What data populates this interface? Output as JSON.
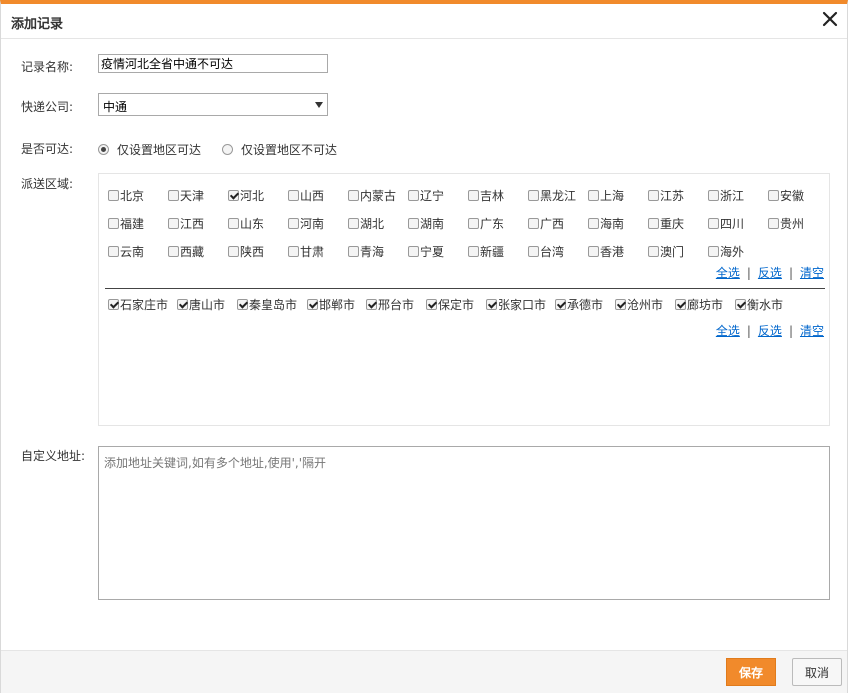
{
  "dialog": {
    "title": "添加记录",
    "close_icon": "close-icon"
  },
  "form": {
    "name_label": "记录名称:",
    "name_value": "疫情河北全省中通不可达",
    "express_label": "快递公司:",
    "express_value": "中通",
    "reachable_label": "是否可达:",
    "radio_options": [
      {
        "label": "仅设置地区可达",
        "checked": true
      },
      {
        "label": "仅设置地区不可达",
        "checked": false
      }
    ],
    "region_label": "派送区域:",
    "custom_label": "自定义地址:",
    "custom_placeholder": "添加地址关键词,如有多个地址,使用','隔开"
  },
  "provinces": [
    {
      "label": "北京",
      "checked": false
    },
    {
      "label": "天津",
      "checked": false
    },
    {
      "label": "河北",
      "checked": true
    },
    {
      "label": "山西",
      "checked": false
    },
    {
      "label": "内蒙古",
      "checked": false
    },
    {
      "label": "辽宁",
      "checked": false
    },
    {
      "label": "吉林",
      "checked": false
    },
    {
      "label": "黑龙江",
      "checked": false
    },
    {
      "label": "上海",
      "checked": false
    },
    {
      "label": "江苏",
      "checked": false
    },
    {
      "label": "浙江",
      "checked": false
    },
    {
      "label": "安徽",
      "checked": false
    },
    {
      "label": "福建",
      "checked": false
    },
    {
      "label": "江西",
      "checked": false
    },
    {
      "label": "山东",
      "checked": false
    },
    {
      "label": "河南",
      "checked": false
    },
    {
      "label": "湖北",
      "checked": false
    },
    {
      "label": "湖南",
      "checked": false
    },
    {
      "label": "广东",
      "checked": false
    },
    {
      "label": "广西",
      "checked": false
    },
    {
      "label": "海南",
      "checked": false
    },
    {
      "label": "重庆",
      "checked": false
    },
    {
      "label": "四川",
      "checked": false
    },
    {
      "label": "贵州",
      "checked": false
    },
    {
      "label": "云南",
      "checked": false
    },
    {
      "label": "西藏",
      "checked": false
    },
    {
      "label": "陕西",
      "checked": false
    },
    {
      "label": "甘肃",
      "checked": false
    },
    {
      "label": "青海",
      "checked": false
    },
    {
      "label": "宁夏",
      "checked": false
    },
    {
      "label": "新疆",
      "checked": false
    },
    {
      "label": "台湾",
      "checked": false
    },
    {
      "label": "香港",
      "checked": false
    },
    {
      "label": "澳门",
      "checked": false
    },
    {
      "label": "海外",
      "checked": false
    }
  ],
  "cities": [
    {
      "label": "石家庄市",
      "checked": true
    },
    {
      "label": "唐山市",
      "checked": true
    },
    {
      "label": "秦皇岛市",
      "checked": true
    },
    {
      "label": "邯郸市",
      "checked": true
    },
    {
      "label": "邢台市",
      "checked": true
    },
    {
      "label": "保定市",
      "checked": true
    },
    {
      "label": "张家口市",
      "checked": true
    },
    {
      "label": "承德市",
      "checked": true
    },
    {
      "label": "沧州市",
      "checked": true
    },
    {
      "label": "廊坊市",
      "checked": true
    },
    {
      "label": "衡水市",
      "checked": true
    }
  ],
  "links": {
    "select_all": "全选",
    "invert": "反选",
    "clear": "清空",
    "sep": "|"
  },
  "footer": {
    "save_label": "保存",
    "cancel_label": "取消"
  },
  "colors": {
    "accent": "#f18a2b",
    "link": "#0066cc"
  }
}
